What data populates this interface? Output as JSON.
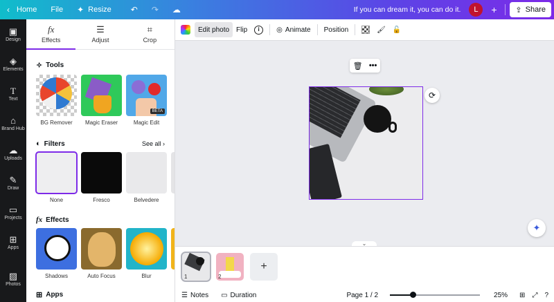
{
  "topbar": {
    "home": "Home",
    "file": "File",
    "resize": "Resize",
    "tagline": "If you can dream it, you can do it.",
    "avatar_initial": "L",
    "share": "Share"
  },
  "rail": {
    "items": [
      {
        "label": "Design",
        "icon": "design-icon"
      },
      {
        "label": "Elements",
        "icon": "elements-icon"
      },
      {
        "label": "Text",
        "icon": "text-icon"
      },
      {
        "label": "Brand Hub",
        "icon": "brand-hub-icon"
      },
      {
        "label": "Uploads",
        "icon": "uploads-icon"
      },
      {
        "label": "Draw",
        "icon": "draw-icon"
      },
      {
        "label": "Projects",
        "icon": "projects-icon"
      },
      {
        "label": "Apps",
        "icon": "apps-icon"
      },
      {
        "label": "Photos",
        "icon": "photos-icon"
      }
    ]
  },
  "panel": {
    "tabs": [
      {
        "label": "Effects",
        "active": true
      },
      {
        "label": "Adjust",
        "active": false
      },
      {
        "label": "Crop",
        "active": false
      }
    ],
    "tools_heading": "Tools",
    "tools": [
      {
        "label": "BG Remover"
      },
      {
        "label": "Magic Eraser"
      },
      {
        "label": "Magic Edit",
        "badge": "BETA"
      }
    ],
    "filters_heading": "Filters",
    "see_all": "See all",
    "filters": [
      {
        "label": "None",
        "selected": true
      },
      {
        "label": "Fresco",
        "selected": false
      },
      {
        "label": "Belvedere",
        "selected": false
      }
    ],
    "effects_heading": "Effects",
    "effects": [
      {
        "label": "Shadows"
      },
      {
        "label": "Auto Focus"
      },
      {
        "label": "Blur"
      }
    ],
    "apps_heading": "Apps"
  },
  "toolbar": {
    "edit_photo": "Edit photo",
    "flip": "Flip",
    "animate": "Animate",
    "position": "Position"
  },
  "pages": {
    "items": [
      {
        "number": "1",
        "selected": true
      },
      {
        "number": "2",
        "selected": false
      }
    ]
  },
  "bottombar": {
    "notes": "Notes",
    "duration": "Duration",
    "page_indicator": "Page 1 / 2",
    "zoom_percent": 25,
    "zoom_label": "25%"
  },
  "colors": {
    "accent": "#7d2ae8",
    "rail_bg": "#18191b",
    "avatar_bg": "#c0132e"
  }
}
